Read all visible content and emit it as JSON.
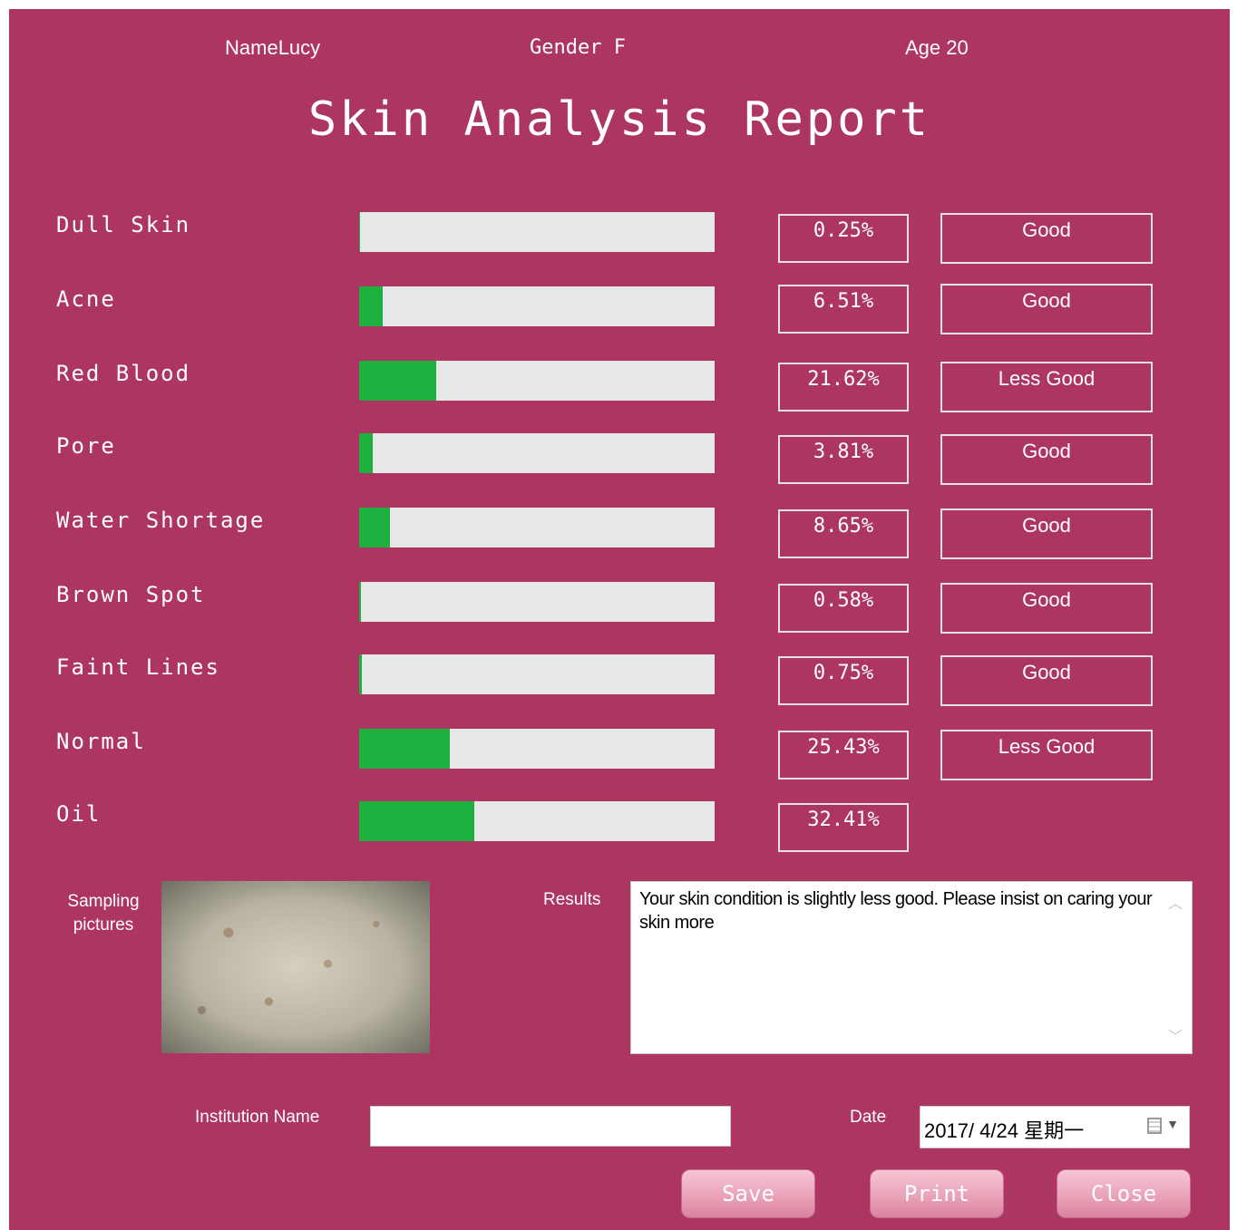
{
  "header": {
    "name_label": "Name",
    "name_value": "Lucy",
    "gender_label": "Gender",
    "gender_value": "F",
    "age_label": "Age",
    "age_value": "20",
    "title": "Skin Analysis Report"
  },
  "metrics": [
    {
      "label": "Dull Skin",
      "percent_text": "0.25%",
      "level": 0.25,
      "rating": "Good"
    },
    {
      "label": "Acne",
      "percent_text": "6.51%",
      "level": 6.51,
      "rating": "Good"
    },
    {
      "label": "Red Blood",
      "percent_text": "21.62%",
      "level": 21.62,
      "rating": "Less Good"
    },
    {
      "label": "Pore",
      "percent_text": "3.81%",
      "level": 3.81,
      "rating": "Good"
    },
    {
      "label": "Water Shortage",
      "percent_text": "8.65%",
      "level": 8.65,
      "rating": "Good"
    },
    {
      "label": "Brown Spot",
      "percent_text": "0.58%",
      "level": 0.58,
      "rating": "Good"
    },
    {
      "label": "Faint Lines",
      "percent_text": "0.75%",
      "level": 0.75,
      "rating": "Good"
    },
    {
      "label": "Normal",
      "percent_text": "25.43%",
      "level": 25.43,
      "rating": "Less Good"
    },
    {
      "label": "Oil",
      "percent_text": "32.41%",
      "level": 32.41,
      "rating": ""
    }
  ],
  "sampling": {
    "label_line1": "Sampling",
    "label_line2": "pictures"
  },
  "results": {
    "label": "Results",
    "text": "Your skin condition is slightly less good. Please insist on caring your skin more"
  },
  "institution": {
    "label": "Institution Name",
    "value": ""
  },
  "date": {
    "label": "Date",
    "value": "2017/ 4/24 星期一"
  },
  "buttons": {
    "save": "Save",
    "print": "Print",
    "close": "Close"
  },
  "colors": {
    "background": "#ad3561",
    "bar_fill": "#1db03f",
    "bar_track": "#e8e8e8"
  }
}
